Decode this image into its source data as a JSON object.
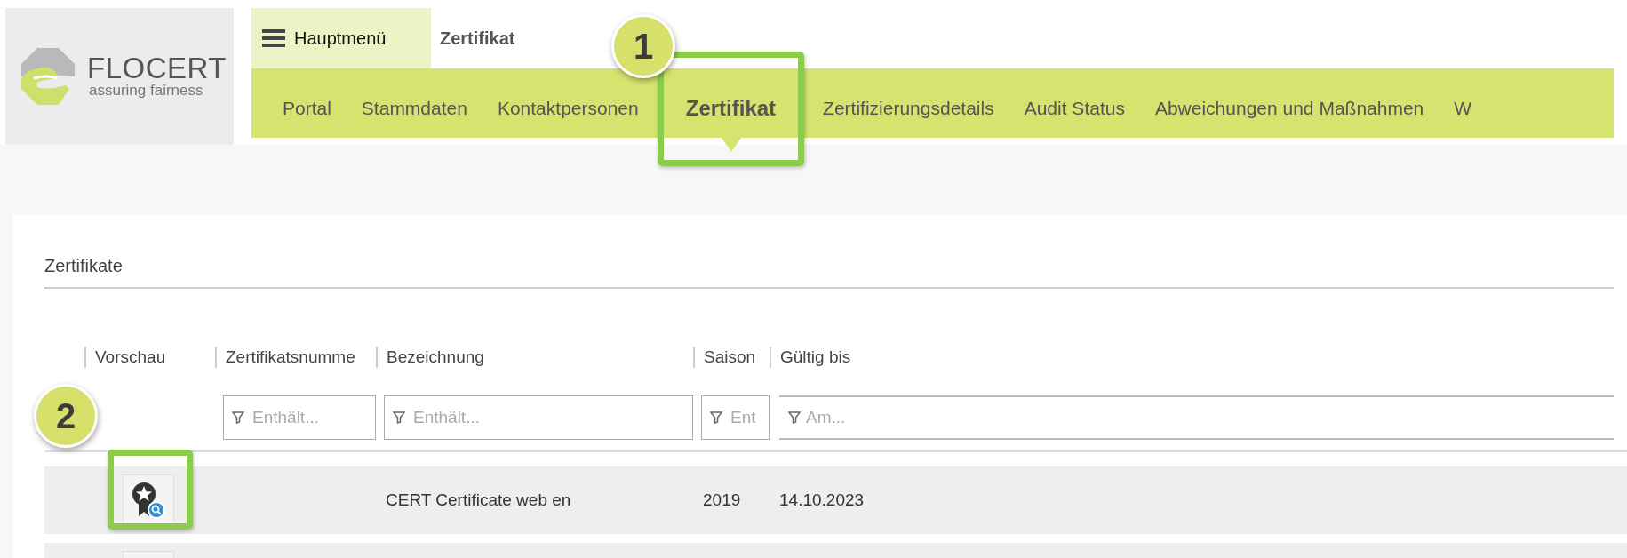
{
  "logo": {
    "name": "FLOCERT",
    "tagline": "assuring fairness"
  },
  "header": {
    "menu_button": "Hauptmenü",
    "breadcrumb": "Zertifikat"
  },
  "nav": [
    {
      "label": "Portal",
      "selected": false
    },
    {
      "label": "Stammdaten",
      "selected": false
    },
    {
      "label": "Kontaktpersonen",
      "selected": false
    },
    {
      "label": "Zertifikat",
      "selected": true
    },
    {
      "label": "Zertifizierungsdetails",
      "selected": false
    },
    {
      "label": "Audit Status",
      "selected": false
    },
    {
      "label": "Abweichungen und Maßnahmen",
      "selected": false
    },
    {
      "label": "W",
      "selected": false
    }
  ],
  "panel": {
    "title": "Zertifikate",
    "columns": [
      {
        "label": "Vorschau"
      },
      {
        "label": "Zertifikatsnumme",
        "filter_placeholder": "Enthält..."
      },
      {
        "label": "Bezeichnung",
        "filter_placeholder": "Enthält..."
      },
      {
        "label": "Saison",
        "filter_placeholder": "Ent"
      },
      {
        "label": "Gültig bis",
        "filter_placeholder": "Am..."
      }
    ],
    "rows": [
      {
        "bezeichnung": "CERT Certificate web en",
        "saison": "2019",
        "gueltig_bis": "14.10.2023"
      },
      {}
    ]
  },
  "callouts": [
    {
      "number": "1"
    },
    {
      "number": "2"
    }
  ]
}
